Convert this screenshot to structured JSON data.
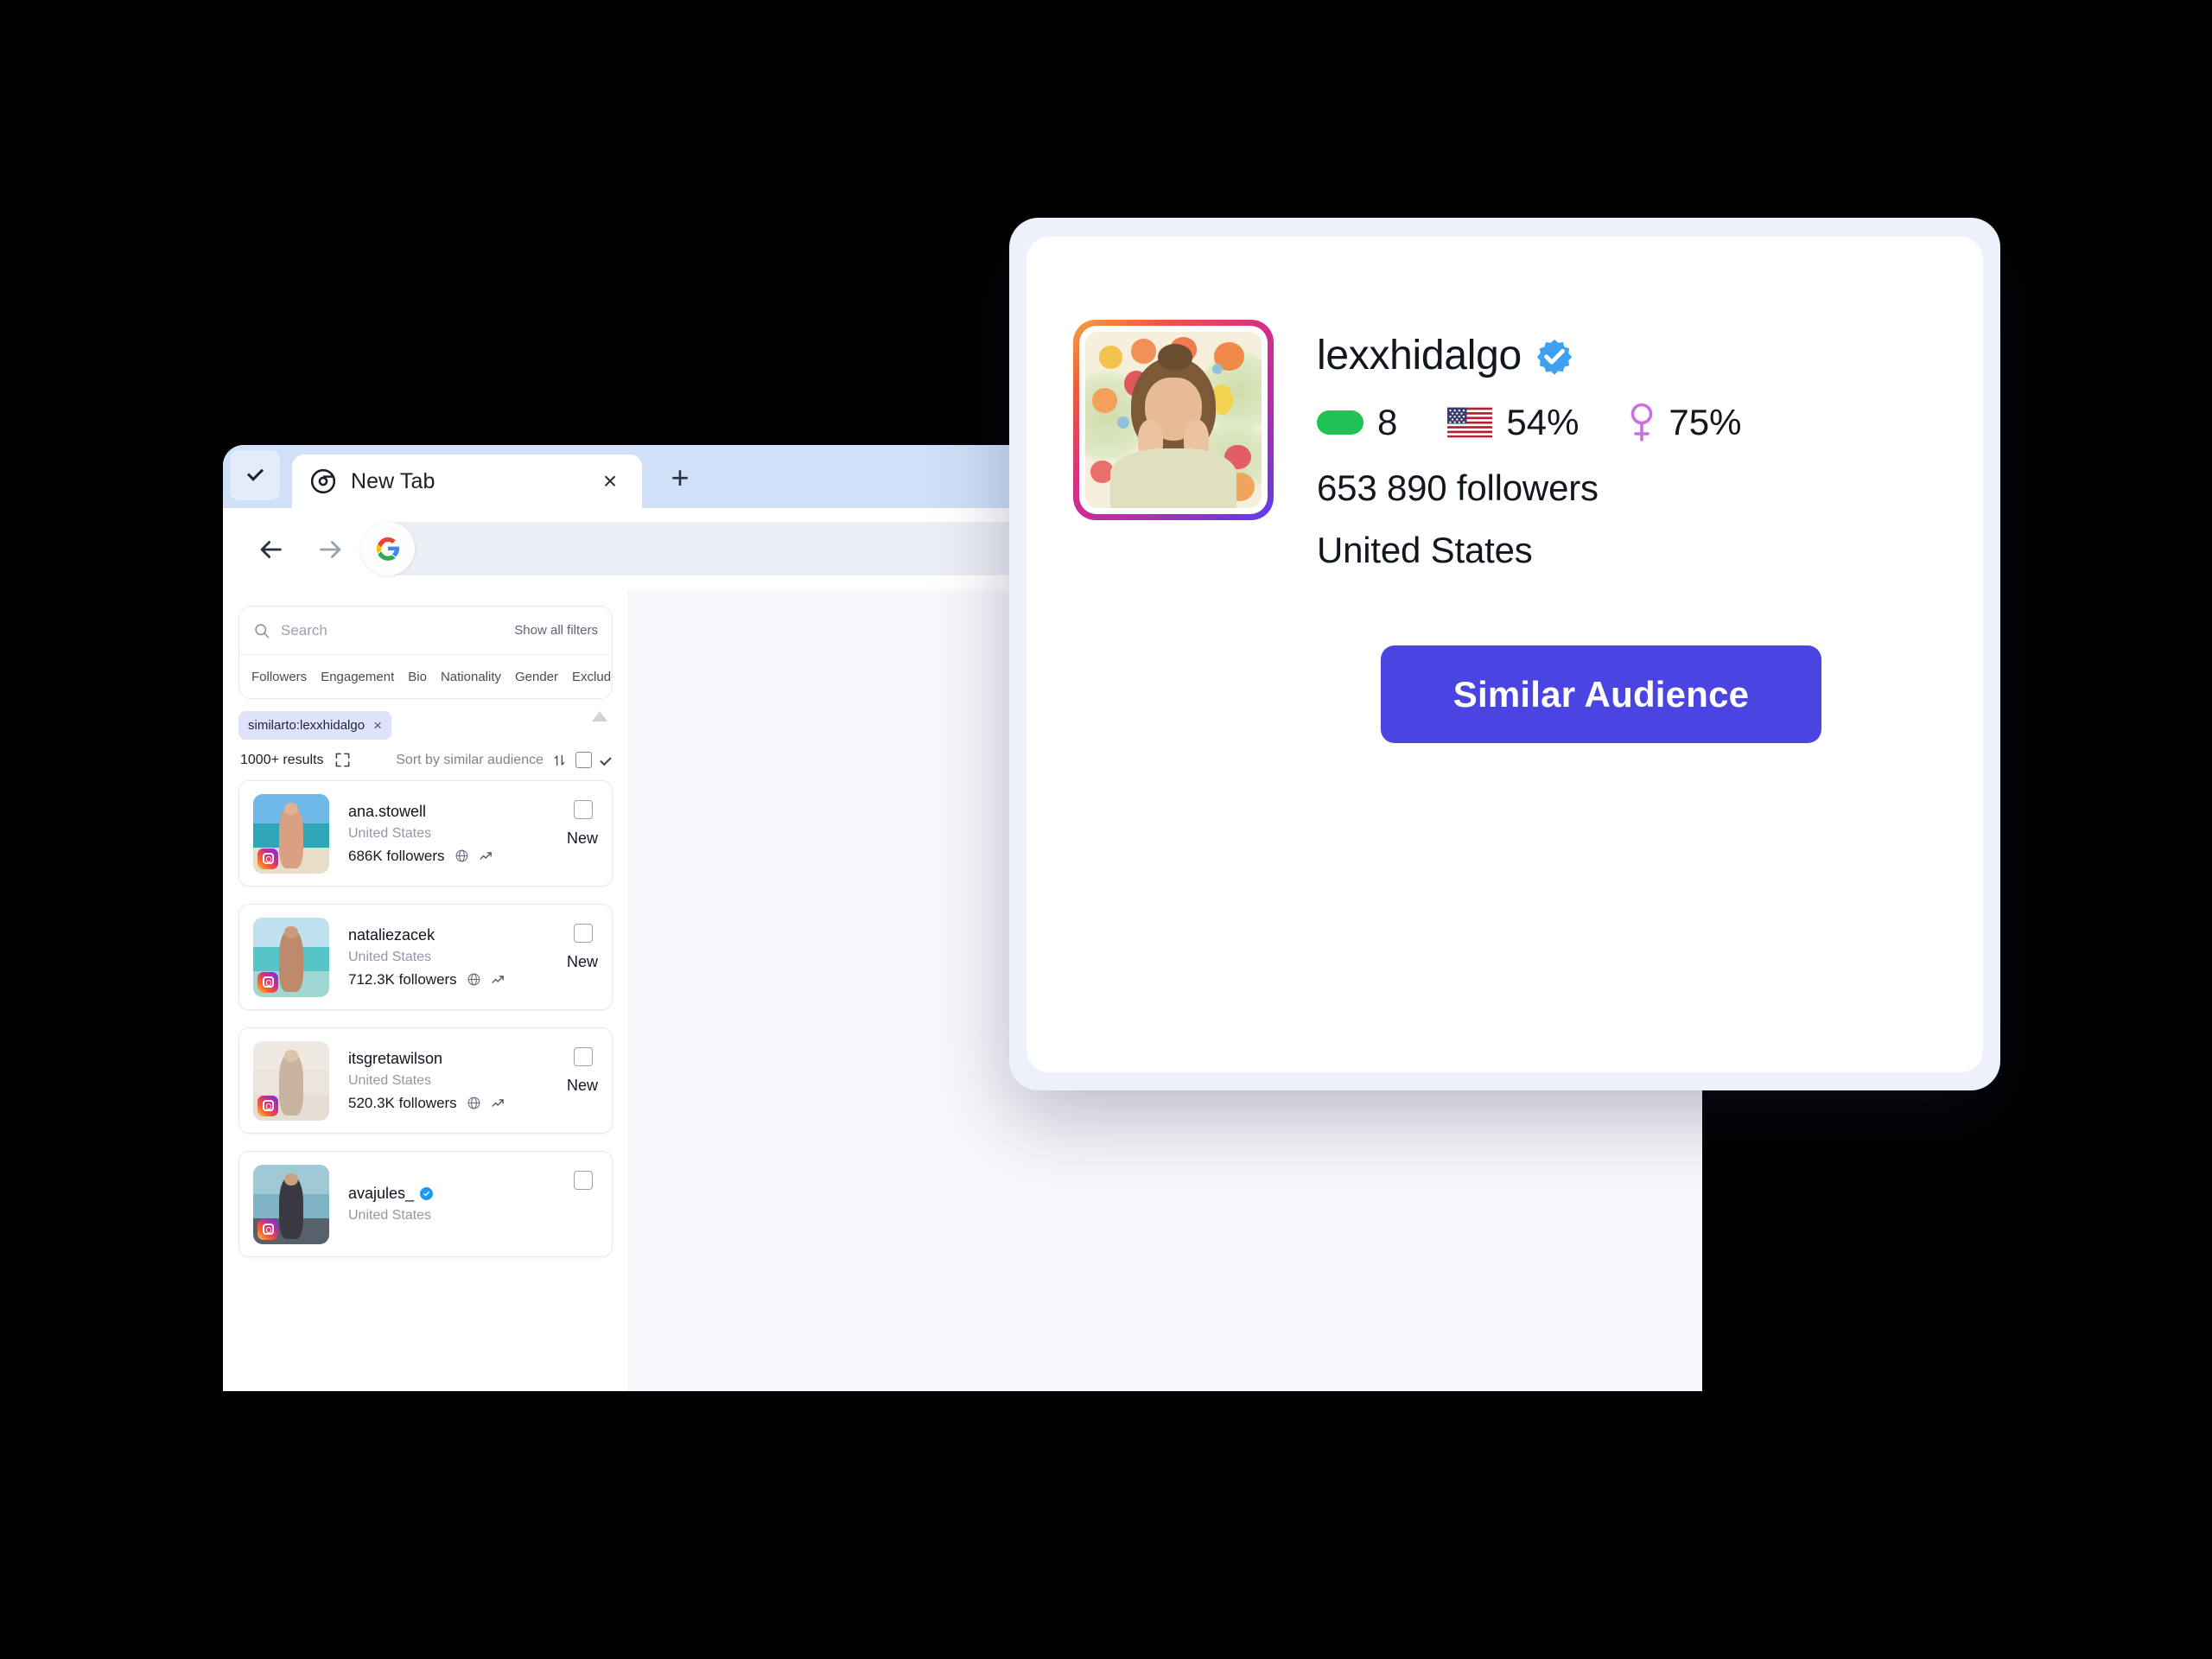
{
  "browser": {
    "tab": {
      "title": "New Tab",
      "favicon": "chrome-icon",
      "close": "×"
    },
    "new_tab_button": "+",
    "tabstrip_chevron": "chevron-down-icon",
    "toolbar": {
      "back": "back-arrow-icon",
      "forward": "forward-arrow-icon",
      "reload": "reload-icon",
      "omnibox_icon": "google-icon",
      "omnibox_value": ""
    }
  },
  "app": {
    "search": {
      "placeholder": "Search",
      "value": "",
      "icon": "search-icon"
    },
    "show_all_filters": "Show all filters",
    "filters": [
      "Followers",
      "Engagement",
      "Bio",
      "Nationality",
      "Gender",
      "Exclude"
    ],
    "chips": [
      {
        "label": "similarto:lexxhidalgo",
        "remove": "×"
      }
    ],
    "results": {
      "count_label": "1000+ results",
      "expand_icon": "expand-icon",
      "sort_label": "Sort by similar audience",
      "sort_icon": "sort-updown-icon",
      "select_all": false,
      "dropdown_icon": "chevron-down-icon"
    },
    "cards": [
      {
        "username": "ana.stowell",
        "location": "United States",
        "followers": "686K followers",
        "badge": "New",
        "verified": false,
        "platform": "instagram",
        "icons": [
          "globe-icon",
          "growth-icon"
        ],
        "selected": false,
        "colors": {
          "sky": "#6fb9e8",
          "sea": "#2fa6b8",
          "sand": "#e8ddc8",
          "body": "#d9a083",
          "head": "#e0b294"
        }
      },
      {
        "username": "nataliezacek",
        "location": "United States",
        "followers": "712.3K followers",
        "badge": "New",
        "verified": false,
        "platform": "instagram",
        "icons": [
          "globe-icon",
          "growth-icon"
        ],
        "selected": false,
        "colors": {
          "sky": "#bfe0ee",
          "sea": "#57c4c8",
          "sand": "#9fd8d3",
          "body": "#bf8a6c",
          "head": "#cb9a7c"
        }
      },
      {
        "username": "itsgretawilson",
        "location": "United States",
        "followers": "520.3K followers",
        "badge": "New",
        "verified": false,
        "platform": "instagram",
        "icons": [
          "globe-icon",
          "growth-icon"
        ],
        "selected": false,
        "colors": {
          "sky": "#efe9e4",
          "sea": "#ece5de",
          "sand": "#e6ded5",
          "body": "#c9b49f",
          "head": "#dcc3ab"
        }
      },
      {
        "username": "avajules_",
        "location": "United States",
        "followers": "",
        "badge": "",
        "verified": true,
        "platform": "instagram",
        "icons": [],
        "selected": false,
        "colors": {
          "sky": "#9fc9d4",
          "sea": "#7fb4c4",
          "sand": "#56616b",
          "body": "#3b3a42",
          "head": "#c9a084"
        }
      }
    ]
  },
  "overlay": {
    "avatar": "profile-photo",
    "username": "lexxhidalgo",
    "verified": true,
    "stats": [
      {
        "icon": "green-pill-icon",
        "value": "8"
      },
      {
        "icon": "us-flag-icon",
        "value": "54%"
      },
      {
        "icon": "female-symbol-icon",
        "value": "75%"
      }
    ],
    "followers": "653 890 followers",
    "country": "United States",
    "cta_label": "Similar Audience"
  },
  "colors": {
    "accent": "#4a45e0",
    "chip_bg": "#dfe2fb",
    "verified_blue": "#1d9bf0",
    "green": "#1fc355",
    "female_pink": "#cb6fe0",
    "overlay_frame": "#eef0fc",
    "tabstrip": "#cfe0f8"
  }
}
